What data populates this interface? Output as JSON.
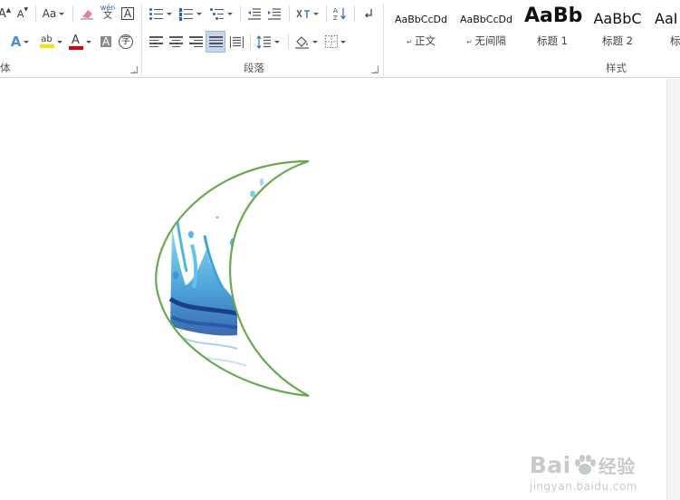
{
  "ribbon": {
    "font_group": {
      "label": "体",
      "grow_a": "A",
      "shrink_a": "A",
      "change_case": "Aa",
      "phonetic_top": "wén",
      "phonetic_bottom": "文",
      "border_char": "A",
      "text_effect": "A",
      "highlight_letters": "ab",
      "font_color": "A",
      "shading_char": "A",
      "enclosed_char": "字"
    },
    "paragraph_group": {
      "label": "段落"
    },
    "styles_group": {
      "label": "样式",
      "items": [
        {
          "sample": "AaBbCcDd",
          "name": "正文"
        },
        {
          "sample": "AaBbCcDd",
          "name": "无间隔"
        },
        {
          "sample": "AaBb",
          "name": "标题 1"
        },
        {
          "sample": "AaBbC",
          "name": "标题 2"
        },
        {
          "sample": "AaI",
          "name": "标"
        }
      ]
    },
    "colors": {
      "highlight": "#f5e400",
      "font_color": "#e00000",
      "accent_blue": "#2b62b5",
      "active_bg": "#c5d7ef"
    }
  },
  "document": {
    "shape": {
      "kind": "crescent-moon",
      "outline_color": "#6aa84f",
      "fill": "water-splash-image"
    }
  },
  "watermark": {
    "brand": "Bai",
    "brand_suffix": "经验",
    "url": "jingyan.baidu.com"
  }
}
